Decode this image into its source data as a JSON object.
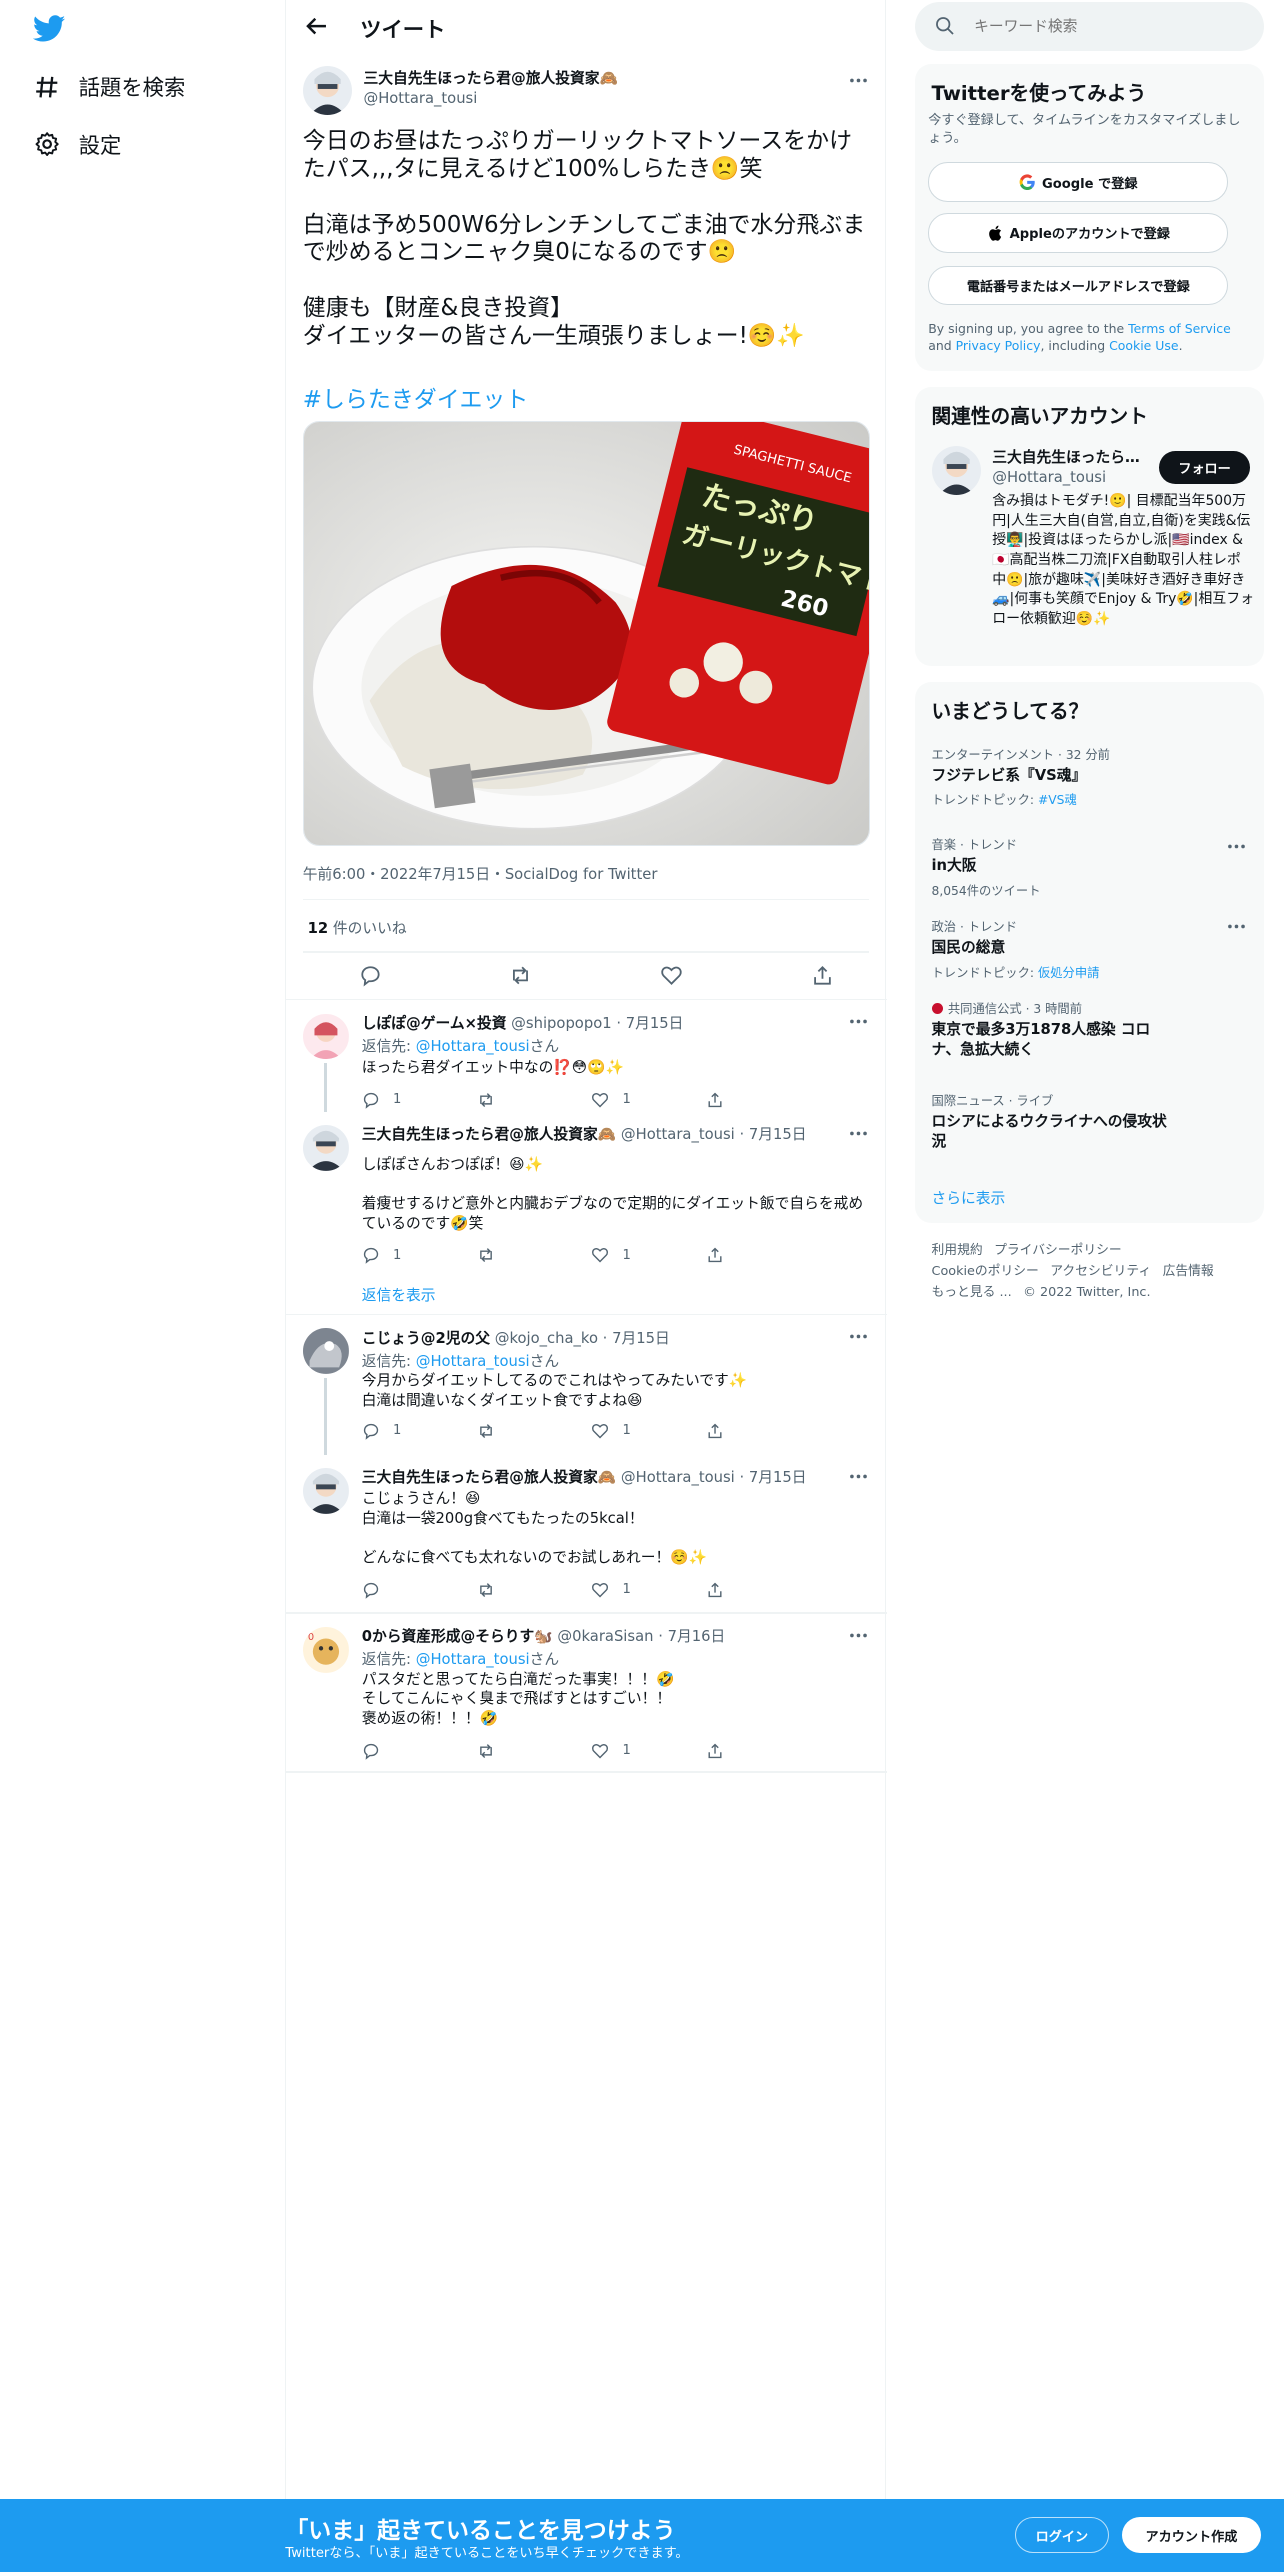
{
  "nav": {
    "explore_label": "話題を検索",
    "settings_label": "設定"
  },
  "header": {
    "title": "ツイート"
  },
  "tweet": {
    "author_name": "三大自先生ほったら君@旅人投資家🙈",
    "author_handle": "@Hottara_tousi",
    "text": "今日のお昼はたっぷりガーリックトマトソースをかけたパス,,,タに見えるけど100%しらたき🙁笑\n\n白滝は予め500W6分レンチンしてごま油で水分飛ぶまで炒めるとコンニャク臭0になるのです🙁\n\n健康も【財産&良き投資】\nダイエッターの皆さん一生頑張りましょー!☺️✨",
    "hashtag": "#しらたきダイエット",
    "meta": "午前6:00・2022年7月15日・SocialDog for Twitter",
    "likes_count": "12",
    "likes_label": " 件のいいね"
  },
  "replies": [
    {
      "name": "しぽぽ@ゲーム×投資",
      "handle": "@shipopopo1",
      "date": "7月15日",
      "reply_to_prefix": "返信先: ",
      "reply_to": "@Hottara_tousi",
      "reply_to_suffix": "さん",
      "text": "ほったら君ダイエット中なの⁉️😳🙄✨",
      "reply_count": "1",
      "retweet_count": "",
      "like_count": "1"
    },
    {
      "name": "三大自先生ほったら君@旅人投資家🙈",
      "handle": "@Hottara_tousi",
      "date": "7月15日",
      "text": "しぽぽさんおつぽぽ！😆✨\n\n着痩せするけど意外と内臓おデブなので定期的にダイエット飯で自らを戒めているのです🤣笑",
      "reply_count": "1",
      "retweet_count": "",
      "like_count": "1",
      "show_replies": "返信を表示"
    },
    {
      "name": "こじょう@2児の父",
      "handle": "@kojo_cha_ko",
      "date": "7月15日",
      "reply_to_prefix": "返信先: ",
      "reply_to": "@Hottara_tousi",
      "reply_to_suffix": "さん",
      "text": "今月からダイエットしてるのでこれはやってみたいです✨\n白滝は間違いなくダイエット食ですよね😆",
      "reply_count": "1",
      "retweet_count": "",
      "like_count": "1"
    },
    {
      "name": "三大自先生ほったら君@旅人投資家🙈",
      "handle": "@Hottara_tousi",
      "date": "7月15日",
      "text": "こじょうさん！😆\n白滝は一袋200g食べてもたったの5kcal！\n\nどんなに食べても太れないのでお試しあれー！☺️✨",
      "reply_count": "",
      "retweet_count": "",
      "like_count": "1"
    },
    {
      "name": "0から資産形成@そらりす🐿️",
      "handle": "@0karaSisan",
      "date": "7月16日",
      "reply_to_prefix": "返信先: ",
      "reply_to": "@Hottara_tousi",
      "reply_to_suffix": "さん",
      "text": "パスタだと思ってたら白滝だった事実！！！🤣\nそしてこんにゃく臭まで飛ばすとはすごい！！\n褒め返の術！！！🤣",
      "reply_count": "",
      "retweet_count": "",
      "like_count": "1"
    }
  ],
  "search": {
    "placeholder": "キーワード検索"
  },
  "signup_card": {
    "title": "Twitterを使ってみよう",
    "desc": "今すぐ登録して、タイムラインをカスタマイズしましょう。",
    "google": "Google で登録",
    "apple": "Appleのアカウントで登録",
    "phone": "電話番号またはメールアドレスで登録",
    "legal_1": "By signing up, you agree to the ",
    "legal_tos": "Terms of Service",
    "legal_2": " and ",
    "legal_privacy": "Privacy Policy",
    "legal_3": ", including ",
    "legal_cookie": "Cookie Use",
    "legal_4": "."
  },
  "related": {
    "title": "関連性の高いアカウント",
    "name": "三大自先生ほったら君@旅人投資家🙈",
    "handle": "@Hottara_tousi",
    "follow": "フォロー",
    "bio": "含み損はトモダチ!🙂| 目標配当年500万円|人生三大自(自営,自立,自衛)を実践&伝授👨‍🏫|投資はほったらかし派|🇺🇸index & 🇯🇵高配当株二刀流|FX自動取引人柱レポ中🙁|旅が趣味✈️|美味好き酒好き車好き🚙|何事も笑顔でEnjoy & Try🤣|相互フォロー依頼歓迎☺️✨"
  },
  "trends": {
    "title": "いまどうしてる？",
    "items": [
      {
        "context": "エンターテインメント · 32 分前",
        "title": "フジテレビ系『VS魂』",
        "sub_prefix": "トレンドトピック: ",
        "sub_link": "#VS魂"
      },
      {
        "context": "音楽 · トレンド",
        "title": "in大阪",
        "sub_prefix": "8,054件のツイート",
        "sub_link": ""
      },
      {
        "context": "政治 · トレンド",
        "title": "国民の総意",
        "sub_prefix": "トレンドトピック: ",
        "sub_link": "仮処分申請"
      },
      {
        "context": "共同通信公式 · 3 時間前",
        "title": "東京で最多3万1878人感染 コロナ、急拡大続く",
        "sub_prefix": "",
        "sub_link": ""
      },
      {
        "context": "国際ニュース · ライブ",
        "title": "ロシアによるウクライナへの侵攻状況",
        "sub_prefix": "",
        "sub_link": ""
      }
    ],
    "show_more": "さらに表示"
  },
  "footer": {
    "links": [
      "利用規約",
      "プライバシーポリシー",
      "Cookieのポリシー",
      "アクセシビリティ",
      "広告情報",
      "もっと見る ..."
    ],
    "copyright": "© 2022 Twitter, Inc."
  },
  "bottombar": {
    "headline": "「いま」起きていることを見つけよう",
    "subline": "Twitterなら、「いま」起きていることをいち早くチェックできます。",
    "login": "ログイン",
    "signup": "アカウント作成"
  },
  "colors": {
    "accent": "#1d9bf0",
    "text": "#0f1419",
    "muted": "#536471"
  }
}
